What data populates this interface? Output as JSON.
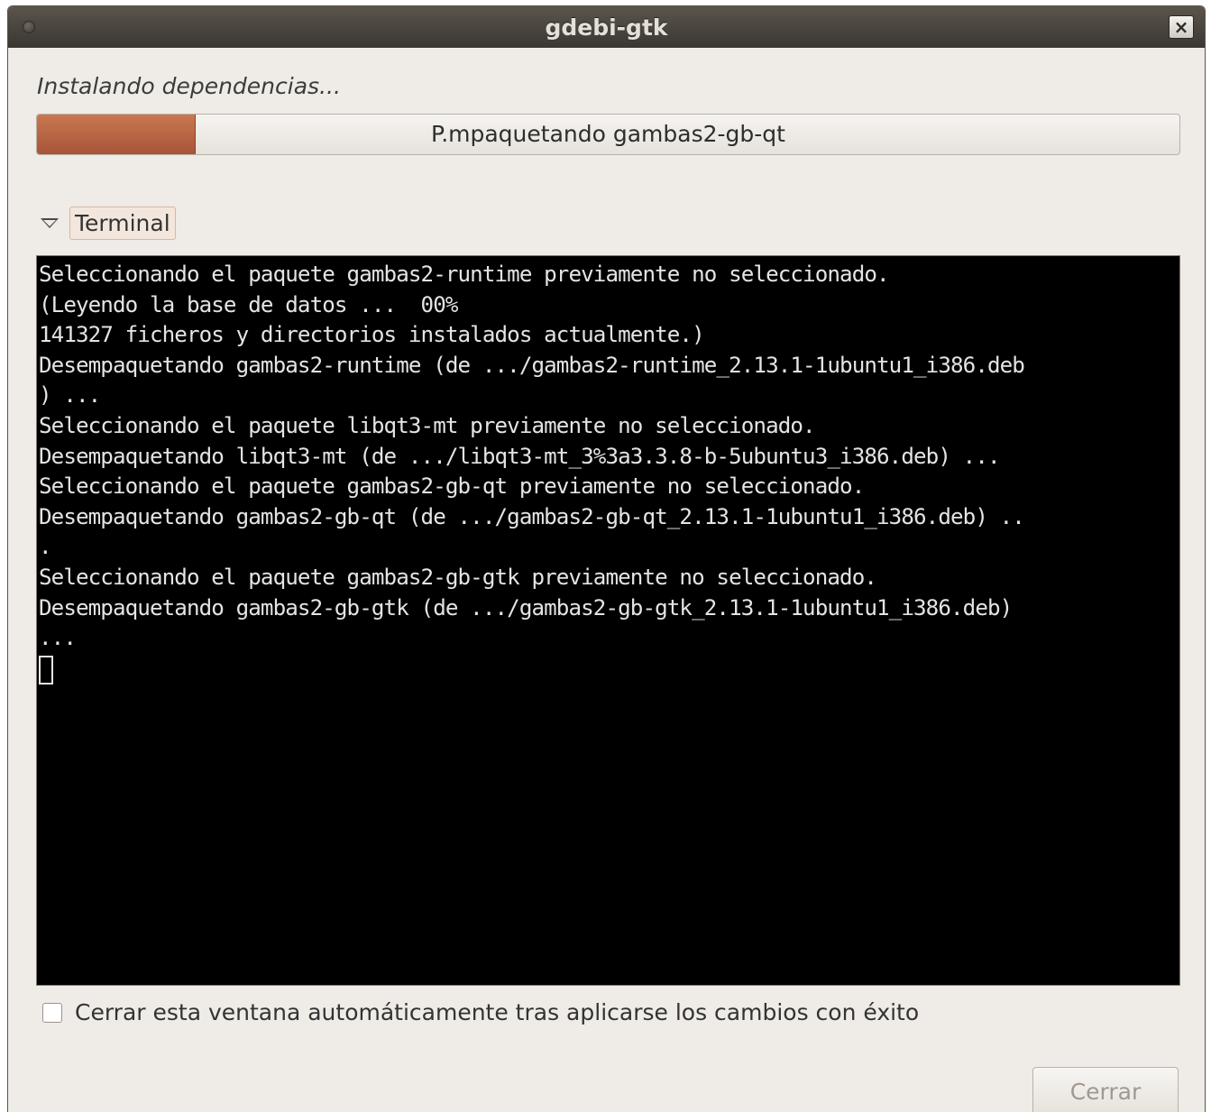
{
  "window": {
    "title": "gdebi-gtk",
    "close_glyph": "×"
  },
  "status": {
    "label": "Instalando dependencias..."
  },
  "progress": {
    "fraction": 0.138,
    "text": "P.mpaquetando gambas2-gb-qt"
  },
  "expander": {
    "label": "Terminal",
    "expanded": true,
    "icon": "triangle-down-icon"
  },
  "terminal": {
    "lines": [
      "Seleccionando el paquete gambas2-runtime previamente no seleccionado.",
      "(Leyendo la base de datos ...  00%",
      "141327 ficheros y directorios instalados actualmente.)",
      "Desempaquetando gambas2-runtime (de .../gambas2-runtime_2.13.1-1ubuntu1_i386.deb",
      ") ...",
      "Seleccionando el paquete libqt3-mt previamente no seleccionado.",
      "Desempaquetando libqt3-mt (de .../libqt3-mt_3%3a3.3.8-b-5ubuntu3_i386.deb) ...",
      "Seleccionando el paquete gambas2-gb-qt previamente no seleccionado.",
      "Desempaquetando gambas2-gb-qt (de .../gambas2-gb-qt_2.13.1-1ubuntu1_i386.deb) ..",
      ".",
      "Seleccionando el paquete gambas2-gb-gtk previamente no seleccionado.",
      "Desempaquetando gambas2-gb-gtk (de .../gambas2-gb-gtk_2.13.1-1ubuntu1_i386.deb)",
      "..."
    ]
  },
  "auto_close": {
    "label": "Cerrar esta ventana automáticamente tras aplicarse los cambios con éxito",
    "checked": false
  },
  "buttons": {
    "close_label": "Cerrar",
    "close_enabled": false
  },
  "colors": {
    "progress_fill": "#b8613f",
    "terminal_bg": "#000000",
    "terminal_fg": "#e4e4e4",
    "window_bg": "#efebe7",
    "titlebar_bg": "#4a453f"
  }
}
